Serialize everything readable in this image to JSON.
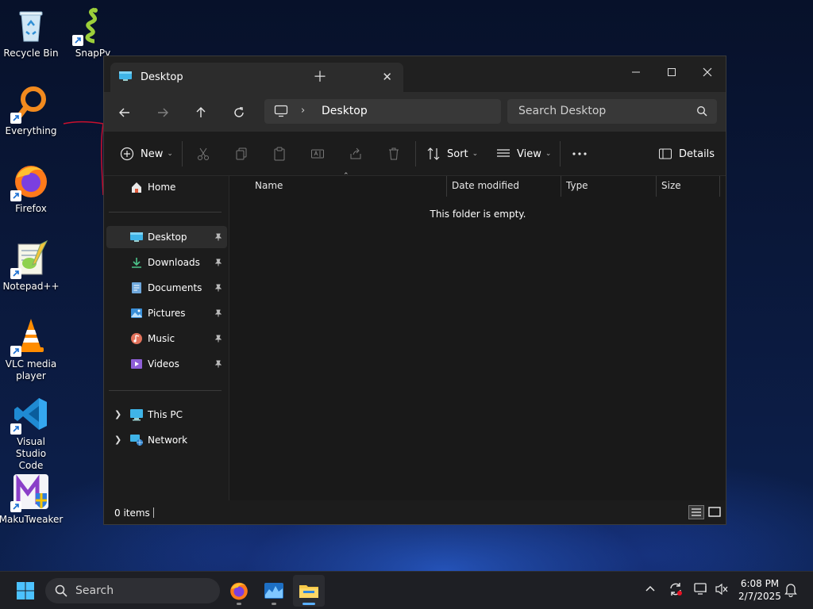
{
  "desktop": {
    "icons": [
      {
        "label": "Recycle Bin",
        "icon": "recycle-bin-icon"
      },
      {
        "label": "SnapPy",
        "icon": "snappy-icon"
      },
      {
        "label": "Everything",
        "icon": "everything-search-icon"
      },
      {
        "label": "Firefox",
        "icon": "firefox-icon"
      },
      {
        "label": "Notepad++",
        "icon": "notepad-plus-plus-icon"
      },
      {
        "label": "VLC media player",
        "icon": "vlc-cone-icon"
      },
      {
        "label": "Visual Studio Code",
        "icon": "vscode-icon"
      },
      {
        "label": "MakuTweaker",
        "icon": "makutweaker-icon"
      }
    ]
  },
  "explorer": {
    "tab_title": "Desktop",
    "address": {
      "path": "Desktop"
    },
    "search": {
      "placeholder": "Search Desktop"
    },
    "commands": {
      "new_label": "New",
      "sort_label": "Sort",
      "view_label": "View",
      "details_label": "Details"
    },
    "sidebar": {
      "home": "Home",
      "quick_access": [
        {
          "label": "Desktop",
          "pinned": true,
          "selected": true
        },
        {
          "label": "Downloads",
          "pinned": true
        },
        {
          "label": "Documents",
          "pinned": true
        },
        {
          "label": "Pictures",
          "pinned": true
        },
        {
          "label": "Music",
          "pinned": true
        },
        {
          "label": "Videos",
          "pinned": true
        }
      ],
      "tree": [
        {
          "label": "This PC"
        },
        {
          "label": "Network"
        }
      ]
    },
    "columns": [
      "Name",
      "Date modified",
      "Type",
      "Size"
    ],
    "empty_message": "This folder is empty.",
    "status": {
      "items": "0 items"
    }
  },
  "taskbar": {
    "search_label": "Search",
    "clock": {
      "time": "6:08 PM",
      "date": "2/7/2025"
    }
  },
  "colors": {
    "accent": "#5ab0ff",
    "window_bg": "#191919",
    "taskbar_bg": "#1e1f24"
  }
}
